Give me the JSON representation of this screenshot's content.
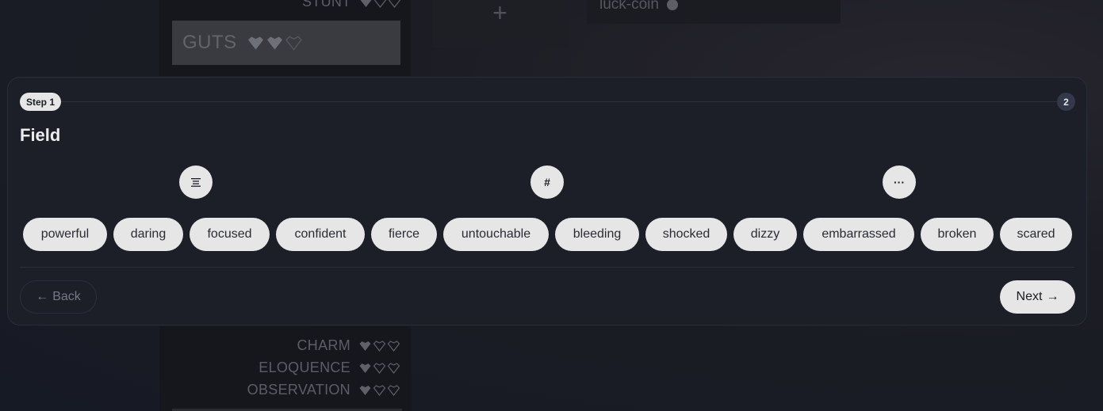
{
  "background": {
    "stats_top": [
      {
        "label": "STUNT",
        "filled": 1,
        "total": 3
      }
    ],
    "guts": {
      "label": "GUTS",
      "filled": 2,
      "total": 3
    },
    "plus_label": "+",
    "coin_label": "luck-coin",
    "stats_bottom": [
      {
        "label": "CHARM",
        "filled": 1,
        "total": 3
      },
      {
        "label": "ELOQUENCE",
        "filled": 1,
        "total": 3
      },
      {
        "label": "OBSERVATION",
        "filled": 1,
        "total": 3
      }
    ]
  },
  "modal": {
    "step_label": "Step 1",
    "next_step_number": "2",
    "title": "Field",
    "category_icons": [
      {
        "name": "lines-icon",
        "glyph": "≡"
      },
      {
        "name": "hash-icon",
        "glyph": "#"
      },
      {
        "name": "more-icon",
        "glyph": "···"
      }
    ],
    "chips": [
      "powerful",
      "daring",
      "focused",
      "confident",
      "fierce",
      "untouchable",
      "bleeding",
      "shocked",
      "dizzy",
      "embarrassed",
      "broken",
      "scared"
    ],
    "back_label": "Back",
    "next_label": "Next",
    "back_icon": "←",
    "next_icon": "→"
  }
}
